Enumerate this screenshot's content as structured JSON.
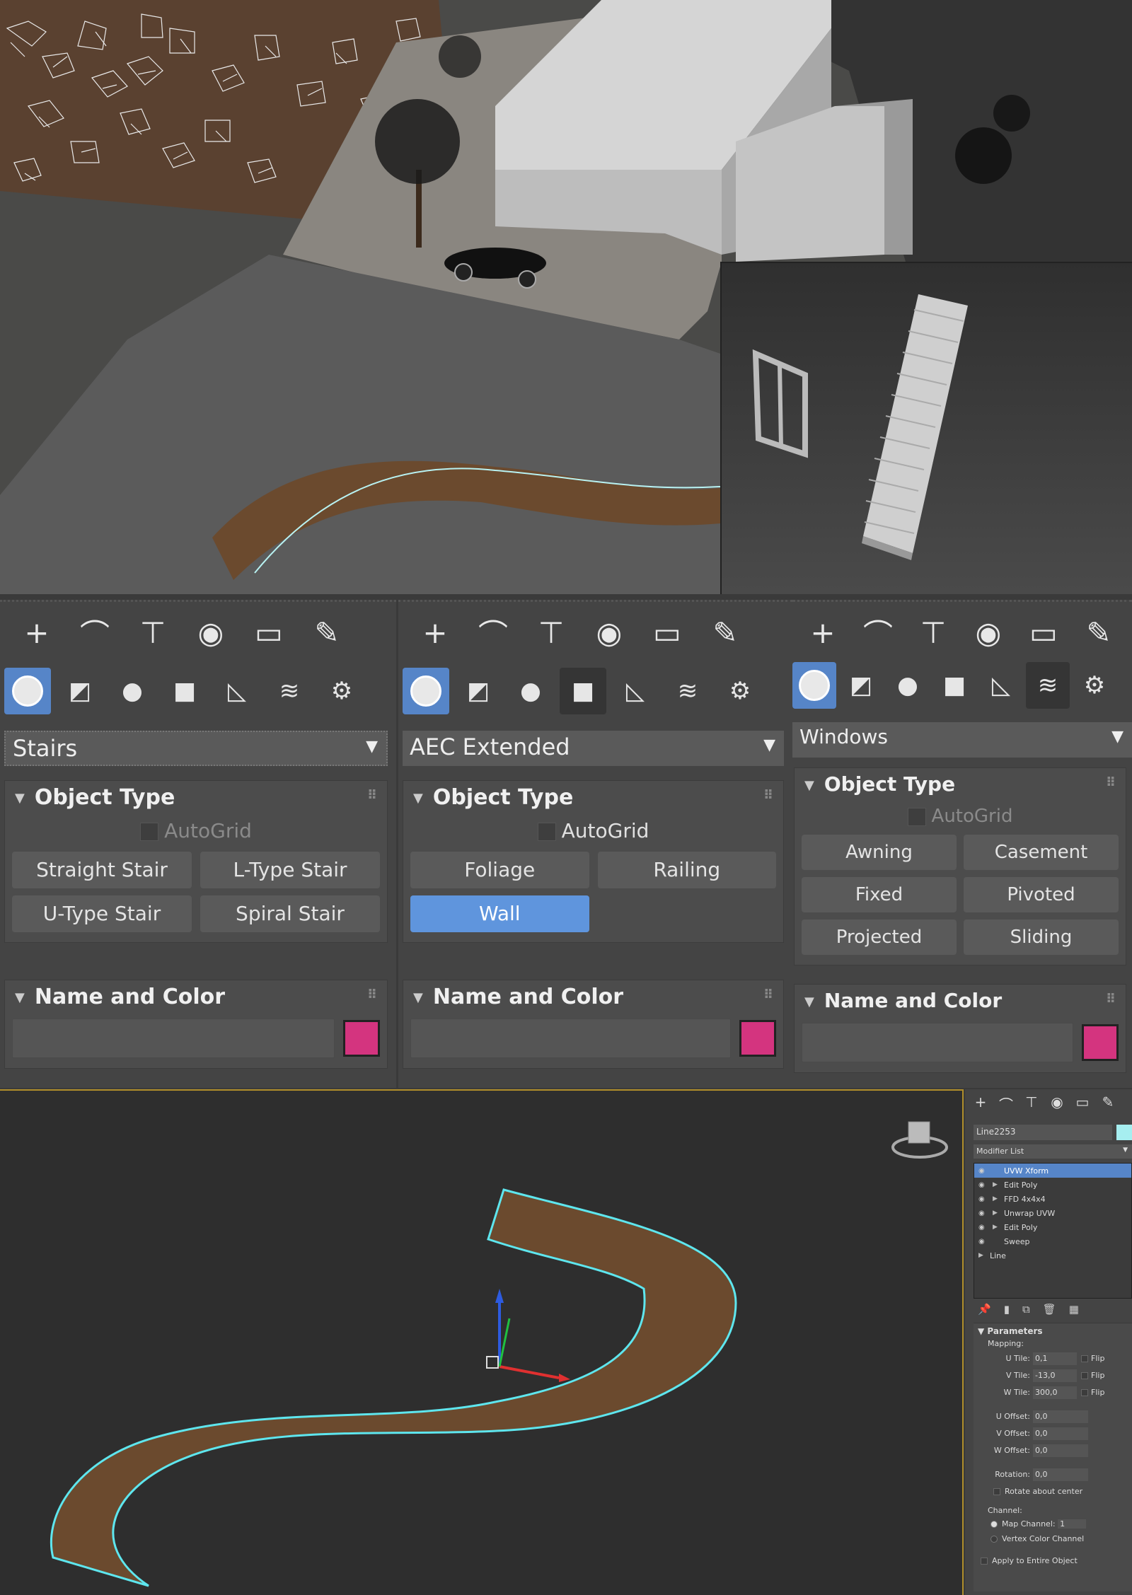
{
  "panels": [
    {
      "dropdown": "Stairs",
      "active_category": "geometry",
      "object_type": {
        "title": "Object Type",
        "autogrid": "AutoGrid",
        "buttons": [
          "Straight Stair",
          "L-Type Stair",
          "U-Type Stair",
          "Spiral Stair"
        ]
      },
      "name_color": {
        "title": "Name and Color",
        "name_value": "",
        "color": "#d4347f"
      }
    },
    {
      "dropdown": "AEC Extended",
      "active_category": "geometry",
      "object_type": {
        "title": "Object Type",
        "autogrid": "AutoGrid",
        "buttons": [
          "Foliage",
          "Railing",
          "Wall"
        ],
        "active_button": "Wall"
      },
      "name_color": {
        "title": "Name and Color",
        "name_value": "",
        "color": "#d4347f"
      }
    },
    {
      "dropdown": "Windows",
      "active_category": "geometry",
      "object_type": {
        "title": "Object Type",
        "autogrid": "AutoGrid",
        "buttons": [
          "Awning",
          "Casement",
          "Fixed",
          "Pivoted",
          "Projected",
          "Sliding"
        ]
      },
      "name_color": {
        "title": "Name and Color",
        "name_value": "",
        "color": "#d4347f"
      }
    }
  ],
  "command_tabs": [
    "create-icon",
    "modify-icon",
    "hierarchy-icon",
    "motion-icon",
    "display-icon",
    "utilities-icon"
  ],
  "categories": [
    "geometry-icon",
    "shapes-icon",
    "lights-icon",
    "cameras-icon",
    "helpers-icon",
    "spacewarps-icon",
    "systems-icon"
  ],
  "modify_panel": {
    "object_name": "Line2253",
    "object_color": "#a6eef0",
    "modifier_list": "Modifier List",
    "stack": [
      {
        "label": "UVW Xform",
        "expandable": false,
        "selected": true
      },
      {
        "label": "Edit Poly",
        "expandable": true,
        "selected": false
      },
      {
        "label": "FFD 4x4x4",
        "expandable": true,
        "selected": false
      },
      {
        "label": "Unwrap UVW",
        "expandable": true,
        "selected": false
      },
      {
        "label": "Edit Poly",
        "expandable": true,
        "selected": false
      },
      {
        "label": "Sweep",
        "expandable": false,
        "selected": false
      },
      {
        "label": "Line",
        "expandable": true,
        "selected": false
      }
    ],
    "parameters": {
      "title": "Parameters",
      "mapping_label": "Mapping:",
      "u_tile_label": "U Tile:",
      "u_tile": "0,1",
      "v_tile_label": "V Tile:",
      "v_tile": "-13,0",
      "w_tile_label": "W Tile:",
      "w_tile": "300,0",
      "flip_label": "Flip",
      "u_offset_label": "U Offset:",
      "u_offset": "0,0",
      "v_offset_label": "V Offset:",
      "v_offset": "0,0",
      "w_offset_label": "W Offset:",
      "w_offset": "0,0",
      "rotation_label": "Rotation:",
      "rotation": "0,0",
      "rotate_center": "Rotate about center",
      "channel_label": "Channel:",
      "map_channel_label": "Map Channel:",
      "map_channel": "1",
      "vertex_color_channel": "Vertex Color Channel",
      "apply_entire": "Apply to Entire Object"
    }
  },
  "colors": {
    "accent": "#5685c8",
    "spline": "#5ee6ee",
    "path": "#6b4a2e"
  }
}
